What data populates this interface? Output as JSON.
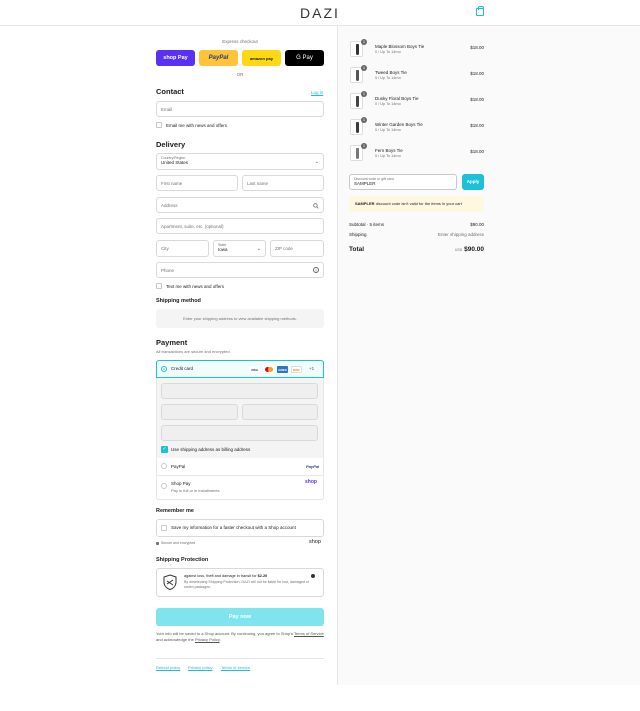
{
  "brand": "DAZI",
  "express": {
    "label": "Express checkout",
    "shop_pay": "shop Pay",
    "paypal": "PayPal",
    "amazon": "amazon pay",
    "gpay": "G Pay",
    "or": "OR"
  },
  "contact": {
    "title": "Contact",
    "login": "Log in",
    "email_placeholder": "Email",
    "newsletter": "Email me with news and offers"
  },
  "delivery": {
    "title": "Delivery",
    "country_label": "Country/Region",
    "country_value": "United States",
    "first_name": "First name",
    "last_name": "Last name",
    "address": "Address",
    "apartment": "Apartment, suite, etc. (optional)",
    "city": "City",
    "state_label": "State",
    "state_value": "Iowa",
    "zip": "ZIP code",
    "phone": "Phone",
    "sms": "Text me with news and offers"
  },
  "shipping_method": {
    "title": "Shipping method",
    "notice": "Enter your shipping address to view available shipping methods."
  },
  "payment": {
    "title": "Payment",
    "subtitle": "All transactions are secure and encrypted.",
    "credit_card": "Credit card",
    "more_cards": "+1",
    "card_logos": [
      "VISA",
      "MC",
      "AMEX",
      "DISC"
    ],
    "billing_same": "Use shipping address as billing address",
    "paypal": "PayPal",
    "paypal_logo": "PayPal",
    "shop_pay": "Shop Pay",
    "shop_pay_sub": "Pay in full or in installments",
    "shop_pay_logo": "shop"
  },
  "remember": {
    "title": "Remember me",
    "save_info": "Save my information for a faster checkout with a Shop account",
    "secure": "Secure and encrypted",
    "shop_logo": "shop"
  },
  "protection": {
    "title": "Shipping Protection",
    "line1_prefix": "against loss, theft and damage in transit for",
    "price": "$2.20",
    "line2": "By deselecting Shipping Protection, DAZI will not be liable for lost, damaged or stolen packages."
  },
  "pay_now": "Pay now",
  "legal": {
    "text1": "Your info will be saved to a Shop account. By continuing, you agree to Shop's",
    "tos": "Terms of Service",
    "text2": "and acknowledge the",
    "privacy": "Privacy Policy",
    "text3": "."
  },
  "footer_links": [
    "Refund policy",
    "Privacy policy",
    "Terms of service"
  ],
  "cart": {
    "items": [
      {
        "name": "Maple Blossom Boys Tie",
        "variant": "0 / Up To 14mo",
        "price": "$18.00",
        "qty": "1"
      },
      {
        "name": "Tweed Boys Tie",
        "variant": "0 / Up To 14mo",
        "price": "$18.00",
        "qty": "1"
      },
      {
        "name": "Dusky Floral Boys Tie",
        "variant": "0 / Up To 14mo",
        "price": "$18.00",
        "qty": "1"
      },
      {
        "name": "Winter Garden Boys Tie",
        "variant": "0 / Up To 14mo",
        "price": "$18.00",
        "qty": "1"
      },
      {
        "name": "Fern Boys Tie",
        "variant": "0 / Up To 14mo",
        "price": "$18.00",
        "qty": "1"
      }
    ],
    "discount_label": "Discount code or gift card",
    "discount_value": "SAMPLER",
    "apply": "Apply",
    "error_code": "SAMPLER",
    "error_text": "discount code isn't valid for the items in your cart",
    "subtotal_label": "Subtotal · 5 items",
    "subtotal_value": "$90.00",
    "shipping_label": "Shipping",
    "shipping_value": "Enter shipping address",
    "total_label": "Total",
    "currency": "USD",
    "total_value": "$90.00"
  },
  "colors": {
    "accent": "#1ec0d6",
    "shop_pay": "#5a31f4",
    "paypal": "#ffc439",
    "amazon": "#ffd814",
    "gpay": "#000000",
    "pay_now_bg": "#7fe4ee",
    "error_bg": "#fff8e1"
  }
}
